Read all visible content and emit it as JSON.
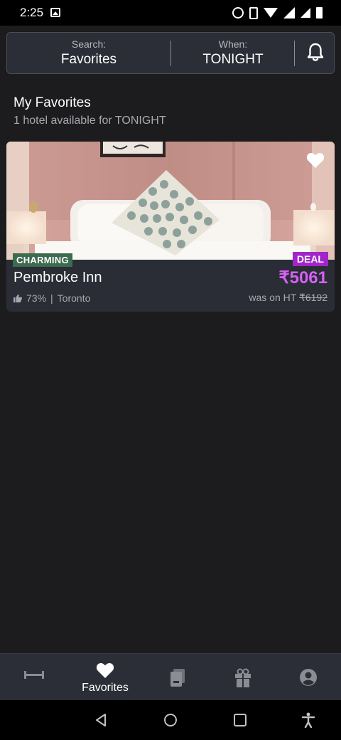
{
  "status_bar": {
    "time": "2:25",
    "icons": [
      "image-icon",
      "alarm-icon",
      "vibrate-icon",
      "wifi-icon",
      "signal-icon",
      "battery-icon"
    ]
  },
  "search": {
    "search_caption": "Search:",
    "search_value": "Favorites",
    "when_caption": "When:",
    "when_value": "TONIGHT",
    "bell_icon": "bell-icon"
  },
  "section": {
    "title": "My Favorites",
    "subtitle": "1 hotel available for TONIGHT"
  },
  "hotel": {
    "tag": "CHARMING",
    "deal_tag": "DEAL",
    "name": "Pembroke Inn",
    "price": "₹5061",
    "rating": "73%",
    "separator": "|",
    "location": "Toronto",
    "was_label": "was on HT",
    "was_price": "₹6192",
    "favorited": true,
    "colors": {
      "price": "#d561f5",
      "deal": "#a126c9",
      "charming": "#3d6b4f"
    }
  },
  "bottom_nav": {
    "items": [
      {
        "icon": "bed-icon",
        "label": ""
      },
      {
        "icon": "heart-icon",
        "label": "Favorites",
        "active": true
      },
      {
        "icon": "bookings-icon",
        "label": ""
      },
      {
        "icon": "gift-icon",
        "label": ""
      },
      {
        "icon": "account-icon",
        "label": ""
      }
    ]
  },
  "android_nav": [
    "back-icon",
    "home-icon",
    "recents-icon",
    "accessibility-icon"
  ]
}
